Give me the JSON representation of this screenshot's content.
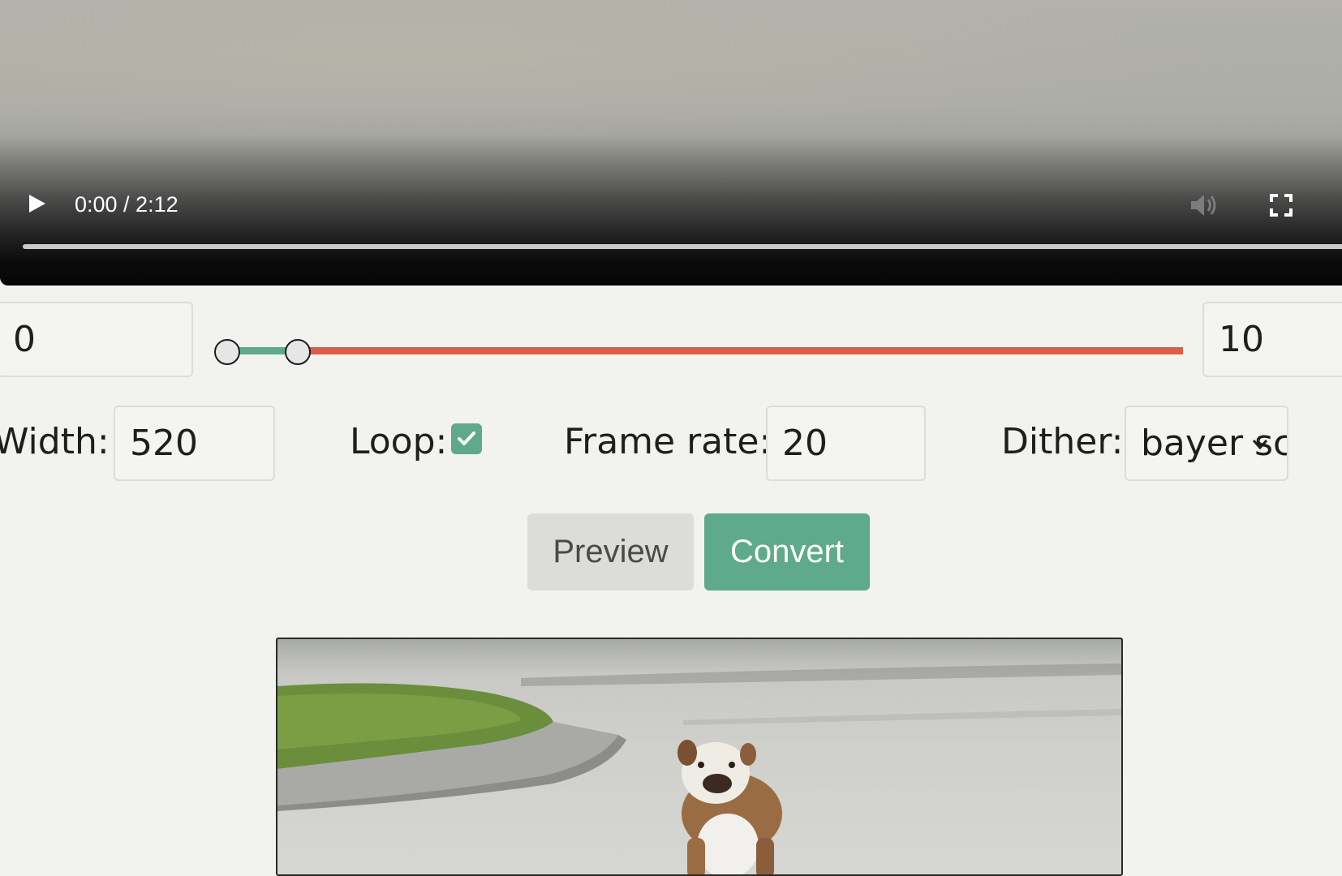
{
  "video_player": {
    "time_display": "0:00 / 2:12",
    "play_icon": "play-icon",
    "volume_icon": "volume-icon",
    "fullscreen_icon": "fullscreen-icon"
  },
  "trim": {
    "start_value": "0",
    "end_value": "10",
    "range_color": "#5fa98c",
    "track_color": "#dc5d49"
  },
  "options": {
    "width_label": "Width:",
    "width_value": "520",
    "loop_label": "Loop:",
    "loop_checked": true,
    "frame_rate_label": "Frame rate:",
    "frame_rate_value": "20",
    "dither_label": "Dither:",
    "dither_value": "bayer sc"
  },
  "buttons": {
    "preview_label": "Preview",
    "convert_label": "Convert"
  },
  "colors": {
    "accent": "#5fa98c",
    "background": "#f2f2ee"
  }
}
